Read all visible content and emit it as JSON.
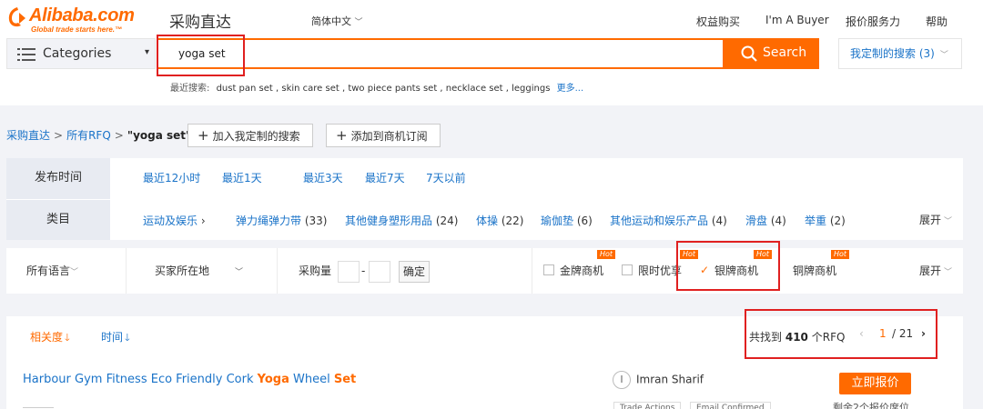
{
  "logo": {
    "name": "Alibaba.com",
    "tagline": "Global trade starts here.™",
    "site_name": "采购直达"
  },
  "language": {
    "label": "简体中文"
  },
  "topnav": [
    "权益购买",
    "I'm A Buyer",
    "报价服务力",
    "帮助"
  ],
  "search": {
    "categories_label": "Categories",
    "query": "yoga set",
    "button_label": "Search",
    "custom_search_label": "我定制的搜索 (3)"
  },
  "recent": {
    "label": "最近搜索:",
    "items": "dust pan set , skin care set , two piece pants set , necklace set , leggings",
    "more": "更多..."
  },
  "breadcrumb": {
    "home": "采购直达",
    "sep": ">",
    "all_rfq": "所有RFQ",
    "current": "\"yoga set\"",
    "add_custom": "加入我定制的搜索",
    "add_subscribe": "添加到商机订阅"
  },
  "filters": {
    "time_label": "发布时间",
    "time_options": [
      "最近12小时",
      "最近1天",
      "最近3天",
      "最近7天",
      "7天以前"
    ],
    "category_label": "类目",
    "category_root": "运动及娱乐",
    "categories": [
      {
        "name": "弹力绳弹力带",
        "count": "(33)"
      },
      {
        "name": "其他健身塑形用品",
        "count": "(24)"
      },
      {
        "name": "体操",
        "count": "(22)"
      },
      {
        "name": "瑜伽垫",
        "count": "(6)"
      },
      {
        "name": "其他运动和娱乐产品",
        "count": "(4)"
      },
      {
        "name": "滑盘",
        "count": "(4)"
      },
      {
        "name": "举重",
        "count": "(2)"
      }
    ],
    "expand": "展开"
  },
  "filters2": {
    "all_languages": "所有语言",
    "buyer_location": "买家所在地",
    "quantity": "采购量",
    "dash": "-",
    "confirm": "确定",
    "hot": "Hot",
    "gold": "金牌商机",
    "limited": "限时优享",
    "silver": "银牌商机",
    "bronze": "铜牌商机",
    "expand": "展开"
  },
  "results": {
    "sort_relevance": "相关度",
    "sort_time": "时间",
    "found_prefix": "共找到",
    "found_count": "410",
    "found_suffix": "个RFQ",
    "page_current": "1",
    "page_total": "/ 21",
    "item": {
      "title_before": "Harbour Gym Fitness Eco Friendly Cork ",
      "title_kw1": "Yoga",
      "title_middle": " Wheel ",
      "title_kw2": "Set",
      "buyer_initial": "I",
      "buyer_name": "Imran Sharif",
      "tags": [
        "Trade Actions",
        "Email Confirmed"
      ],
      "quote_button": "立即报价",
      "remaining": "剩余2个报价席位"
    }
  },
  "colors": {
    "brand": "#ff6a00",
    "link": "#1a73c8",
    "highlight": "#e02020"
  }
}
